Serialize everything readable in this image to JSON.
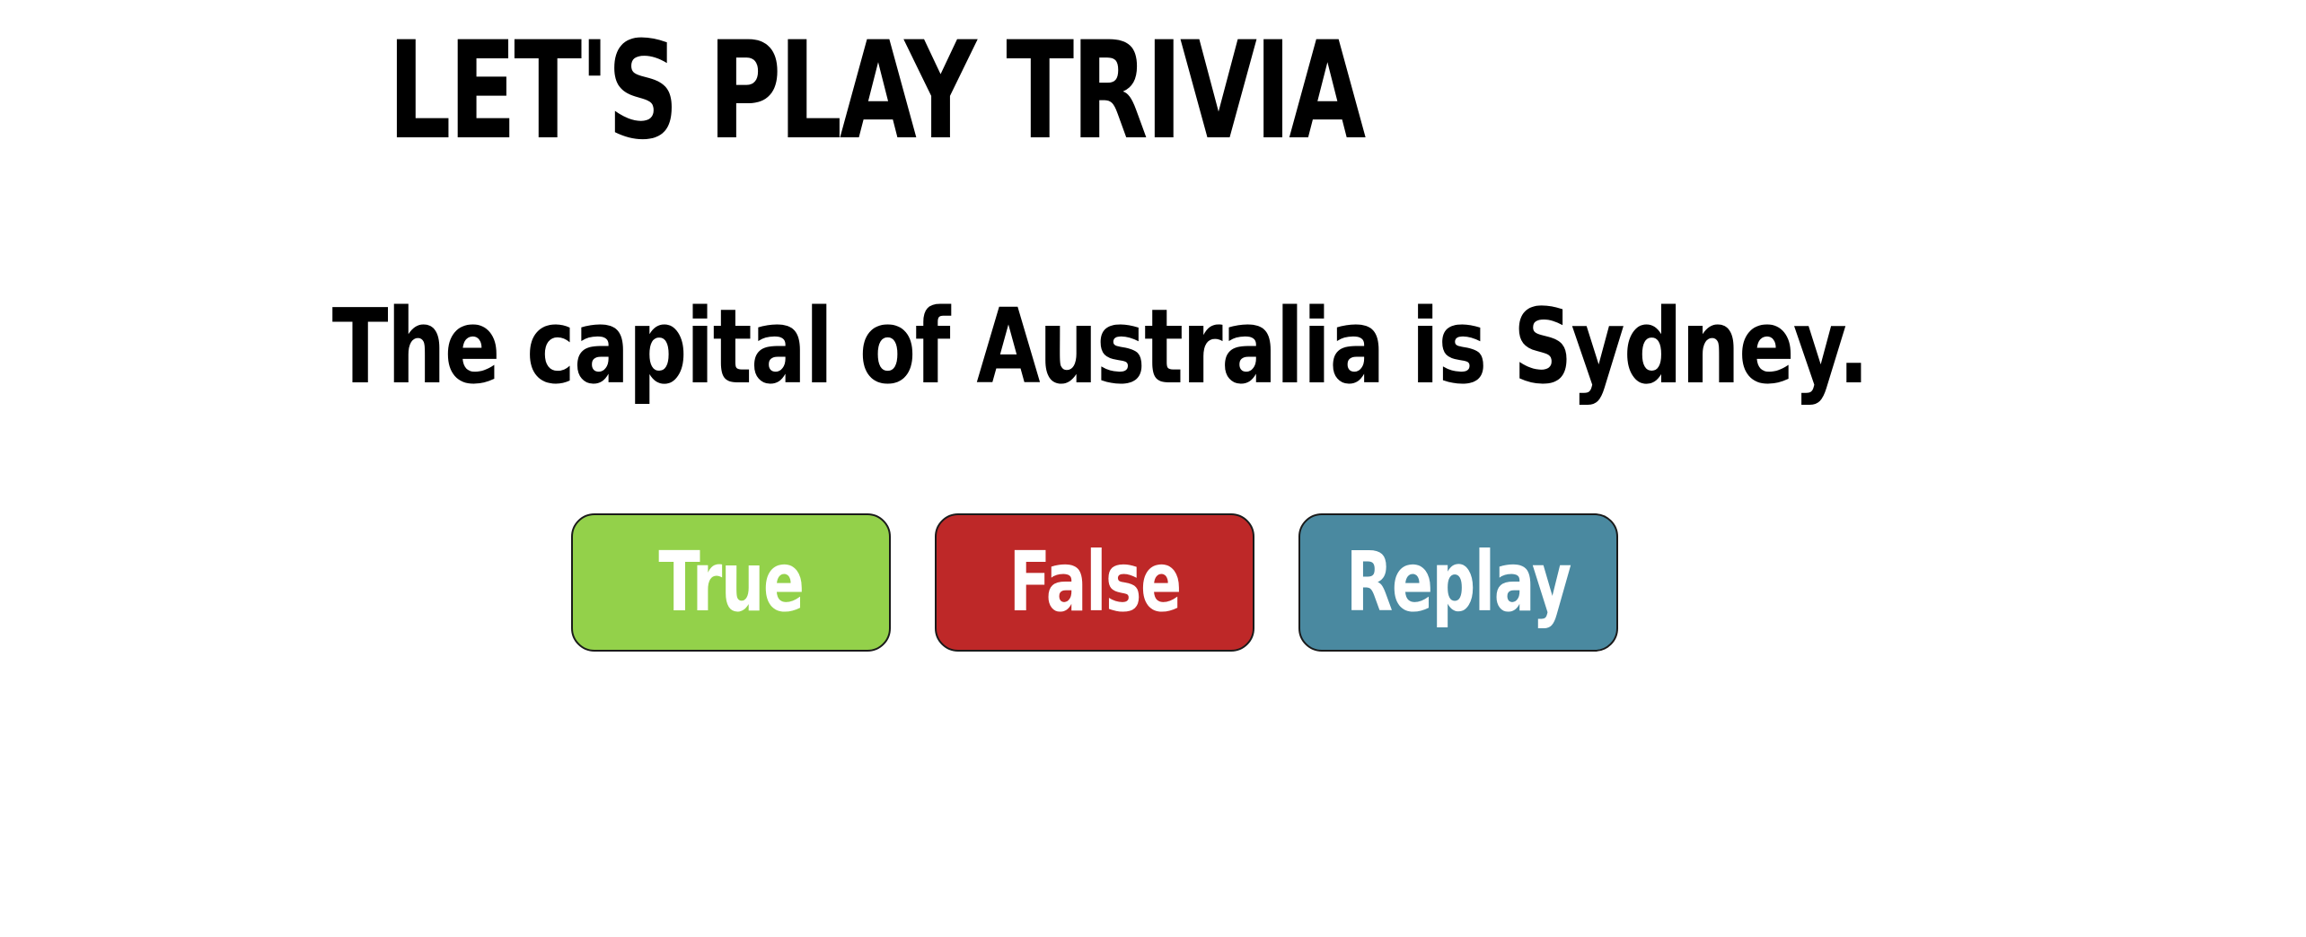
{
  "header": {
    "title": "LET'S PLAY TRIVIA"
  },
  "question": {
    "text": "The capital of Australia is Sydney."
  },
  "buttons": {
    "true": {
      "label": "True",
      "color": "#93d14a"
    },
    "false": {
      "label": "False",
      "color": "#be2828"
    },
    "replay": {
      "label": "Replay",
      "color": "#4a89a0"
    }
  }
}
